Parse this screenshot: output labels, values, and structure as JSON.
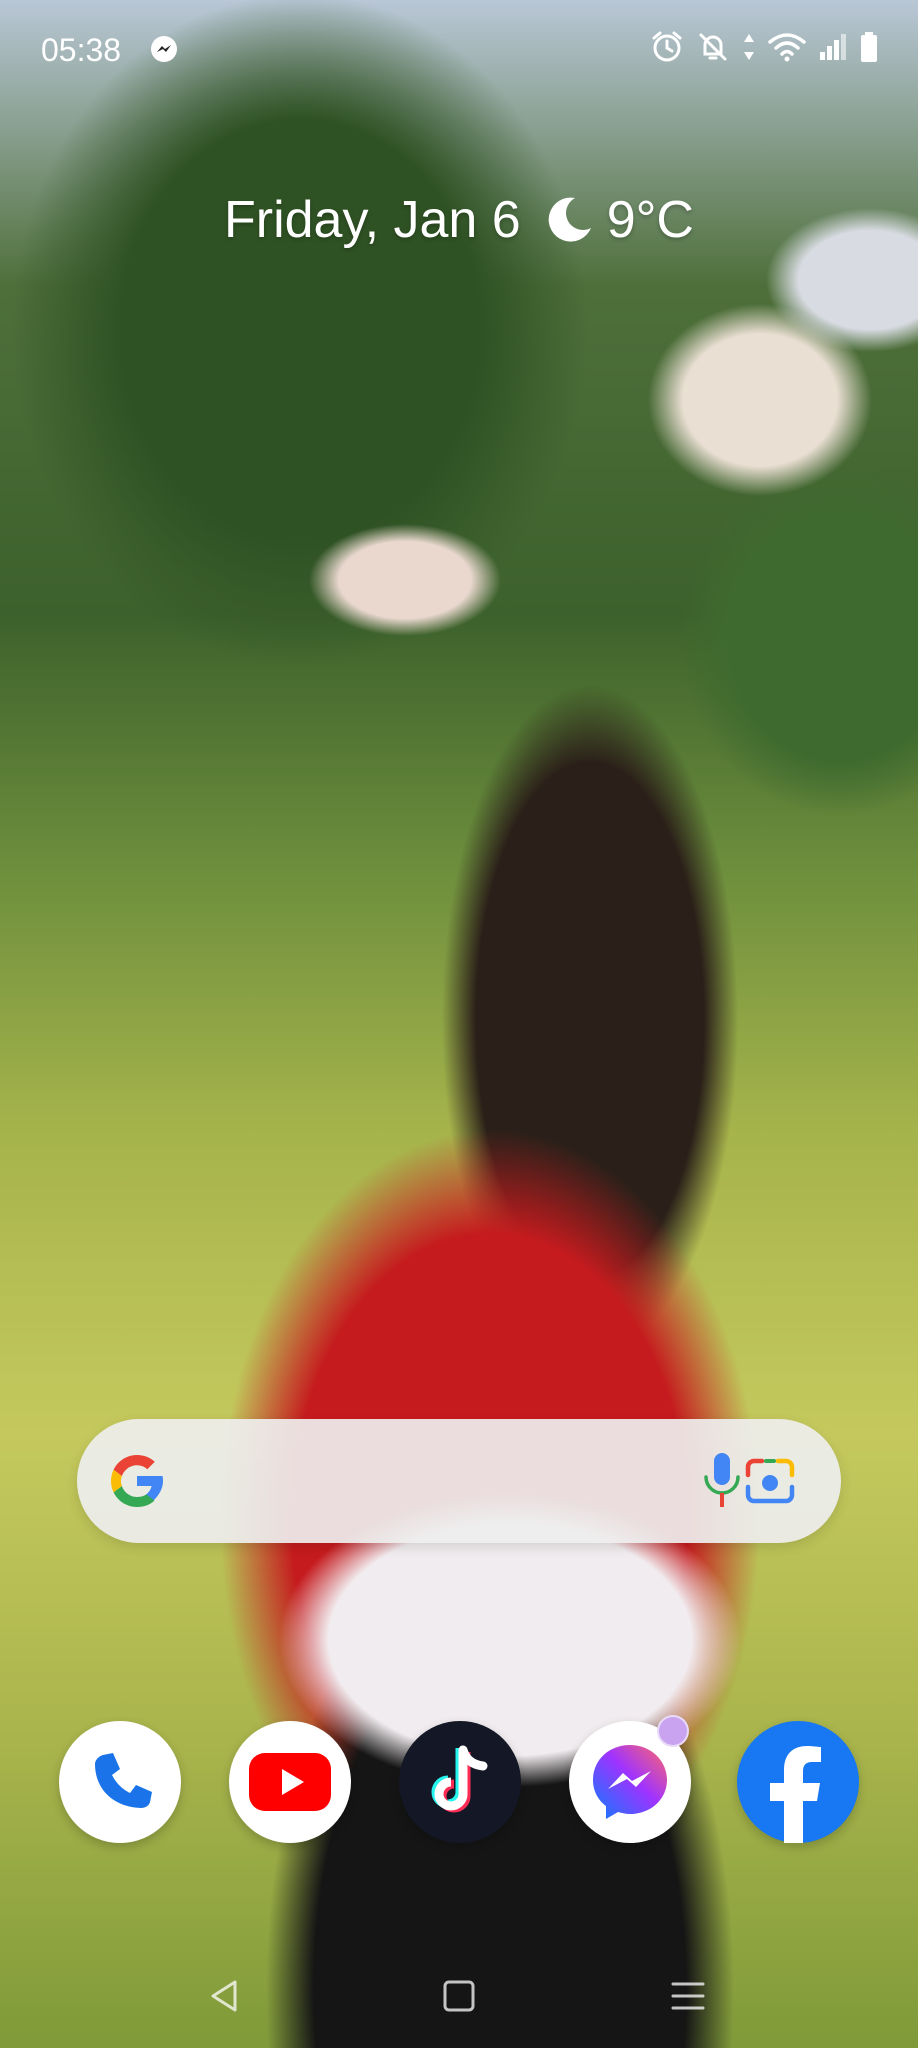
{
  "status_bar": {
    "time": "05:38",
    "left_icons": [
      "messenger-icon"
    ],
    "right_icons": [
      "alarm-icon",
      "bell-muted-icon",
      "data-arrows-icon",
      "wifi-icon",
      "signal-icon",
      "battery-icon"
    ]
  },
  "date_widget": {
    "date": "Friday, Jan 6",
    "weather_icon": "moon-icon",
    "temperature": "9°C"
  },
  "search_bar": {
    "logo": "google-g-icon",
    "mic": "mic-icon",
    "lens": "camera-lens-icon",
    "colors": {
      "bar": "#eeeeee",
      "blue": "#4285F4",
      "red": "#EA4335",
      "yellow": "#FBBC05",
      "green": "#34A853"
    }
  },
  "dock": {
    "apps": [
      {
        "name": "Phone",
        "icon": "phone-icon"
      },
      {
        "name": "YouTube",
        "icon": "youtube-icon"
      },
      {
        "name": "TikTok",
        "icon": "tiktok-icon"
      },
      {
        "name": "Messenger",
        "icon": "messenger-icon",
        "badge": true
      },
      {
        "name": "Facebook",
        "icon": "facebook-icon"
      }
    ]
  },
  "nav_bar": {
    "buttons": [
      "back-icon",
      "home-icon",
      "recents-icon"
    ]
  }
}
